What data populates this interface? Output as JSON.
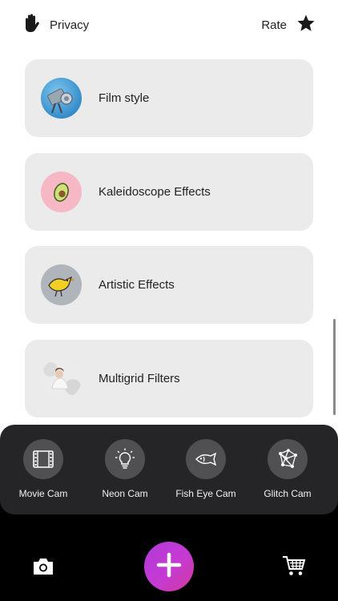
{
  "header": {
    "privacy_label": "Privacy",
    "privacy_icon": "hand-icon",
    "rate_label": "Rate",
    "rate_icon": "star-icon"
  },
  "cards": [
    {
      "label": "Film style",
      "thumb": "film-projector-thumbnail"
    },
    {
      "label": "Kaleidoscope Effects",
      "thumb": "avocado-thumbnail"
    },
    {
      "label": "Artistic Effects",
      "thumb": "bird-graffiti-thumbnail"
    },
    {
      "label": "Multigrid Filters",
      "thumb": "portrait-thumbnail"
    }
  ],
  "cams": [
    {
      "label": "Movie Cam",
      "icon": "film-frame-icon"
    },
    {
      "label": "Neon Cam",
      "icon": "lightbulb-icon"
    },
    {
      "label": "Fish Eye Cam",
      "icon": "fish-icon"
    },
    {
      "label": "Glitch Cam",
      "icon": "network-icon"
    }
  ],
  "bottom_bar": {
    "left_icon": "camera-icon",
    "center_icon": "plus-icon",
    "right_icon": "cart-icon"
  },
  "colors": {
    "card_bg": "#ebebeb",
    "panel_bg": "#252527",
    "fab_gradient_start": "#b23bd9",
    "fab_gradient_end": "#d23a9e"
  }
}
